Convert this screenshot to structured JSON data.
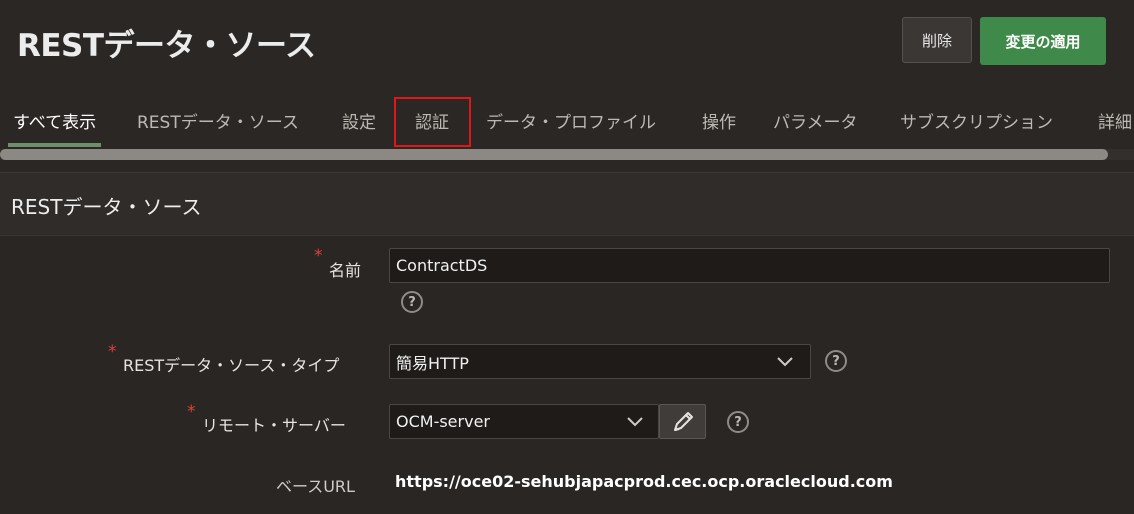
{
  "page": {
    "title": "RESTデータ・ソース"
  },
  "actions": {
    "delete_label": "削除",
    "apply_label": "変更の適用"
  },
  "tabs": [
    {
      "label": "すべて表示",
      "active": true
    },
    {
      "label": "RESTデータ・ソース"
    },
    {
      "label": "設定"
    },
    {
      "label": "認証",
      "highlighted": true
    },
    {
      "label": "データ・プロファイル"
    },
    {
      "label": "操作"
    },
    {
      "label": "パラメータ"
    },
    {
      "label": "サブスクリプション"
    },
    {
      "label": "詳細"
    }
  ],
  "region": {
    "title": "RESTデータ・ソース"
  },
  "form": {
    "required_marker": "*",
    "name": {
      "label": "名前",
      "value": "ContractDS"
    },
    "type": {
      "label": "RESTデータ・ソース・タイプ",
      "value": "簡易HTTP"
    },
    "server": {
      "label": "リモート・サーバー",
      "value": "OCM-server"
    },
    "base_url": {
      "label": "ベースURL",
      "value": "https://oce02-sehubjapacprod.cec.ocp.oraclecloud.com"
    },
    "help_glyph": "?"
  },
  "colors": {
    "accent_green": "#3f8a4a",
    "highlight_red": "#e0161b",
    "required_red": "#e0403a"
  }
}
